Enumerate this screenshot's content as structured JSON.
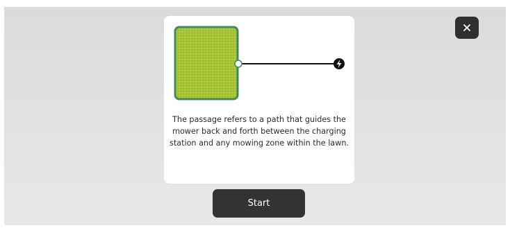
{
  "dialog": {
    "description": "The passage refers to a path that guides the mower back and forth between the charging station and any mowing zone within the lawn.",
    "close_icon": "close-icon",
    "illustration": {
      "zone_icon": "lawn-zone-icon",
      "station_icon": "charging-station-icon"
    }
  },
  "start_button": {
    "label": "Start"
  },
  "colors": {
    "backdrop": "#dcdedd",
    "card": "#ffffff",
    "lawn_fill": "#a8c43a",
    "lawn_border": "#3f8a60",
    "button": "#333333"
  }
}
